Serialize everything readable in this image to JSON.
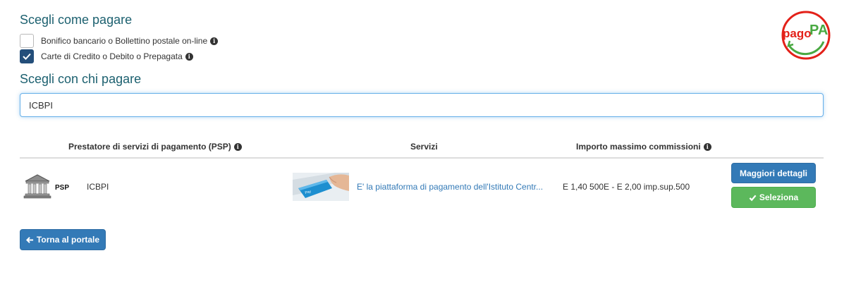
{
  "headings": {
    "how_to_pay": "Scegli come pagare",
    "who_to_pay_with": "Scegli con chi pagare"
  },
  "options": [
    {
      "label": "Bonifico bancario o Bollettino postale on-line",
      "checked": false
    },
    {
      "label": "Carte di Credito o Debito o Prepagata",
      "checked": true
    }
  ],
  "logo": {
    "text_pago": "pago",
    "text_pa": "PA"
  },
  "search": {
    "value": "ICBPI"
  },
  "table": {
    "headers": {
      "psp": "Prestatore di servizi di pagamento (PSP)",
      "services": "Servizi",
      "max_fee": "Importo massimo commissioni"
    },
    "row": {
      "psp_tag": "PSP",
      "psp_name": "ICBPI",
      "service_desc": "E' la piattaforma di pagamento dell'Istituto Centr...",
      "max_fee": "E 1,40 500E - E 2,00 imp.sup.500"
    }
  },
  "buttons": {
    "details": "Maggiori dettagli",
    "select": "Seleziona",
    "back": "Torna al portale"
  },
  "colors": {
    "heading": "#1d6170",
    "primary": "#337ab7",
    "success": "#5cb85c",
    "checkbox_checked": "#234e7a",
    "logo_red": "#e32119",
    "logo_green": "#49a942"
  }
}
